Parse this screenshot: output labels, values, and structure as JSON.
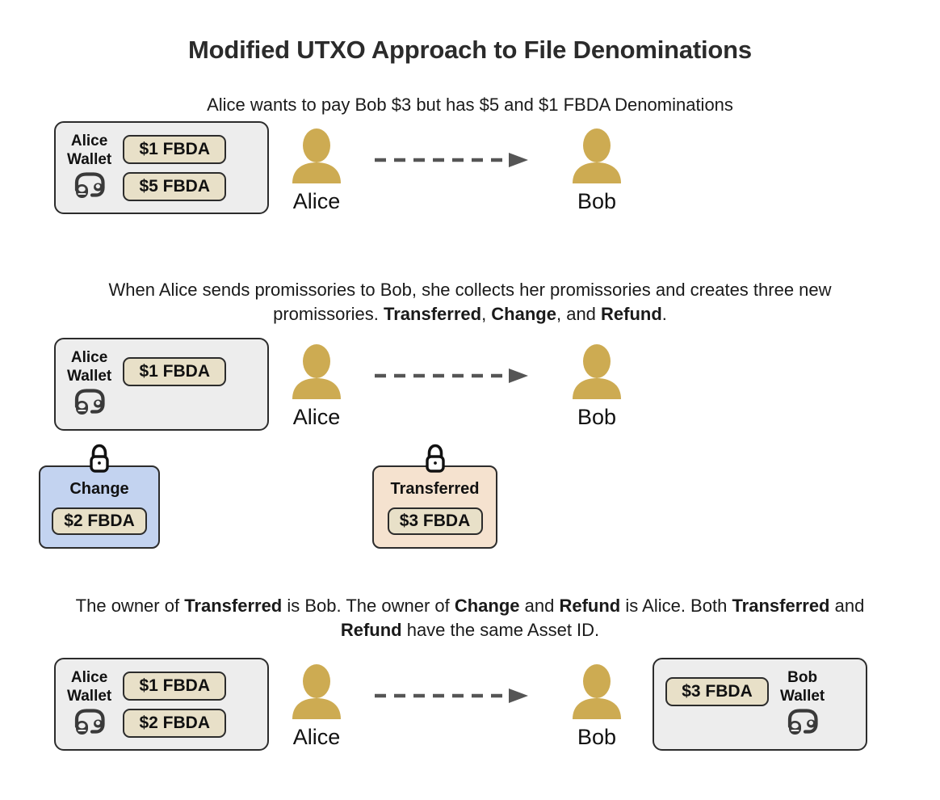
{
  "title": "Modified UTXO Approach to File Denominations",
  "colors": {
    "avatar_gold": "#cdab52",
    "chip_beige": "#e8e0c8",
    "wallet_gray": "#ededed",
    "change_blue": "#c3d3f0",
    "transferred_peach": "#f5e2cf",
    "outline": "#2c2c2c",
    "arrow": "#555555"
  },
  "sections": [
    {
      "id": "section-1",
      "caption_parts": [
        {
          "text": "Alice wants to pay Bob $3 but has $5 and $1 FBDA Denominations",
          "bold": false
        }
      ],
      "alice_wallet": {
        "label": "Alice\nWallet",
        "icon": "wallet-icon",
        "chips": [
          "$1 FBDA",
          "$5 FBDA"
        ]
      },
      "sender": {
        "name": "Alice",
        "icon": "person-avatar-icon"
      },
      "receiver": {
        "name": "Bob",
        "icon": "person-avatar-icon"
      },
      "arrow": "dashed-arrow-right-icon"
    },
    {
      "id": "section-2",
      "caption_parts": [
        {
          "text": "When Alice sends promissories to Bob, she collects her promissories and creates three new promissories. ",
          "bold": false
        },
        {
          "text": "Transferred",
          "bold": true
        },
        {
          "text": ", ",
          "bold": false
        },
        {
          "text": "Change",
          "bold": true
        },
        {
          "text": ", and ",
          "bold": false
        },
        {
          "text": "Refund",
          "bold": true
        },
        {
          "text": ".",
          "bold": false
        }
      ],
      "alice_wallet": {
        "label": "Alice\nWallet",
        "icon": "wallet-icon",
        "chips": [
          "$1 FBDA"
        ]
      },
      "sender": {
        "name": "Alice",
        "icon": "person-avatar-icon"
      },
      "receiver": {
        "name": "Bob",
        "icon": "person-avatar-icon"
      },
      "arrow": "dashed-arrow-right-icon",
      "notes": [
        {
          "title": "Change",
          "chip": "$2 FBDA",
          "lock": "lock-icon",
          "variant": "change"
        },
        {
          "title": "Transferred",
          "chip": "$3 FBDA",
          "lock": "lock-icon",
          "variant": "transferred"
        }
      ]
    },
    {
      "id": "section-3",
      "caption_parts": [
        {
          "text": "The owner of ",
          "bold": false
        },
        {
          "text": "Transferred",
          "bold": true
        },
        {
          "text": " is Bob. The owner of ",
          "bold": false
        },
        {
          "text": "Change",
          "bold": true
        },
        {
          "text": " and ",
          "bold": false
        },
        {
          "text": "Refund",
          "bold": true
        },
        {
          "text": " is Alice. Both ",
          "bold": false
        },
        {
          "text": "Transferred",
          "bold": true
        },
        {
          "text": " and ",
          "bold": false
        },
        {
          "text": "Refund",
          "bold": true
        },
        {
          "text": " have the same Asset ID.",
          "bold": false
        }
      ],
      "alice_wallet": {
        "label": "Alice\nWallet",
        "icon": "wallet-icon",
        "chips": [
          "$1 FBDA",
          "$2 FBDA"
        ]
      },
      "bob_wallet": {
        "label": "Bob\nWallet",
        "icon": "wallet-icon",
        "chips": [
          "$3 FBDA"
        ]
      },
      "sender": {
        "name": "Alice",
        "icon": "person-avatar-icon"
      },
      "receiver": {
        "name": "Bob",
        "icon": "person-avatar-icon"
      },
      "arrow": "dashed-arrow-right-icon"
    }
  ]
}
